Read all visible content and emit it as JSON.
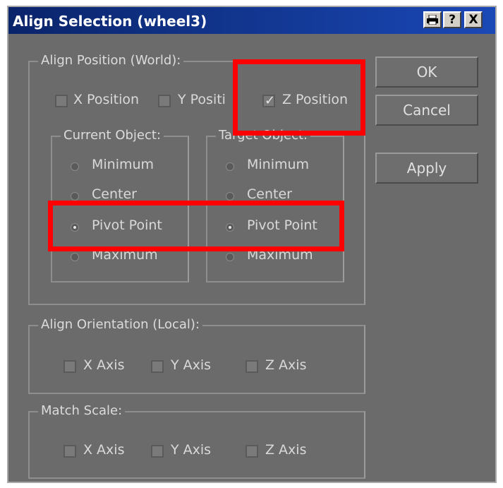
{
  "window": {
    "title": "Align Selection (wheel3)",
    "help_label": "?",
    "close_label": "X"
  },
  "align_position": {
    "legend": "Align Position (World):",
    "x_label": "X Position",
    "x_checked": false,
    "y_label": "Y Positi",
    "y_checked": false,
    "z_label": "Z Position",
    "z_checked": true
  },
  "current_object": {
    "legend": "Current Object:",
    "options": [
      "Minimum",
      "Center",
      "Pivot Point",
      "Maximum"
    ],
    "selected": "Pivot Point"
  },
  "target_object": {
    "legend": "Target Object:",
    "options": [
      "Minimum",
      "Center",
      "Pivot Point",
      "Maximum"
    ],
    "selected": "Pivot Point"
  },
  "align_orientation": {
    "legend": "Align Orientation (Local):",
    "x_label": "X Axis",
    "y_label": "Y Axis",
    "z_label": "Z Axis"
  },
  "match_scale": {
    "legend": "Match Scale:",
    "x_label": "X Axis",
    "y_label": "Y Axis",
    "z_label": "Z Axis"
  },
  "buttons": {
    "ok": "OK",
    "cancel": "Cancel",
    "apply": "Apply"
  },
  "colors": {
    "highlight": "#ff0000",
    "panel": "#6b6b6b",
    "title_bar": "#0a246a"
  }
}
